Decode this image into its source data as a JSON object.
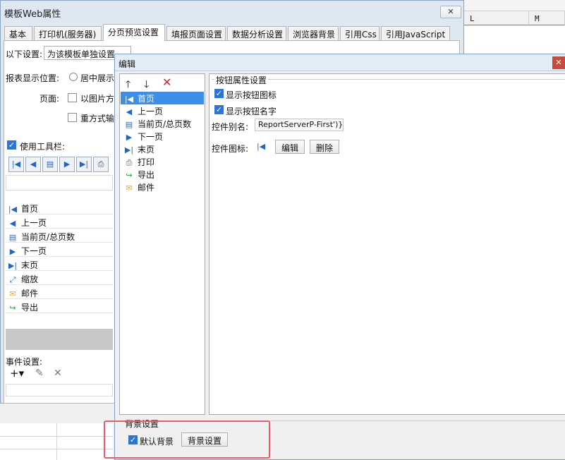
{
  "sheet": {
    "col_l": "L",
    "col_m": "M"
  },
  "main_dialog": {
    "title": "模板Web属性",
    "close_symbol": "✕",
    "tabs": [
      {
        "label": "基本"
      },
      {
        "label": "打印机(服务器)"
      },
      {
        "label": "分页预览设置"
      },
      {
        "label": "填报页面设置"
      },
      {
        "label": "数据分析设置"
      },
      {
        "label": "浏览器背景"
      },
      {
        "label": "引用Css"
      },
      {
        "label": "引用JavaScript"
      }
    ],
    "settings_label": "以下设置:",
    "settings_value": "为该模板单独设置",
    "report_pos_label": "报表显示位置:",
    "report_pos_option": "居中展示",
    "page_label": "页面:",
    "page_option": "以图片方",
    "reflow_option": "重方式输",
    "use_toolbar_label": "使用工具栏:",
    "toolbar_items": [
      {
        "label": "首页",
        "icon": "first-page-icon",
        "glyph": "|◀"
      },
      {
        "label": "上一页",
        "icon": "prev-page-icon",
        "glyph": "◀"
      },
      {
        "label": "当前页/总页数",
        "icon": "page-count-icon",
        "glyph": "▤"
      },
      {
        "label": "下一页",
        "icon": "next-page-icon",
        "glyph": "▶"
      },
      {
        "label": "末页",
        "icon": "last-page-icon",
        "glyph": "▶|"
      },
      {
        "label": "缩放",
        "icon": "zoom-icon",
        "glyph": "⤢"
      },
      {
        "label": "邮件",
        "icon": "mail-icon",
        "glyph": "✉"
      },
      {
        "label": "导出",
        "icon": "export-icon",
        "glyph": "↪"
      }
    ],
    "event_label": "事件设置:",
    "add_symbol": "+▾",
    "edit_symbol": "✎",
    "delete_symbol": "✕"
  },
  "edit_dialog": {
    "title": "编辑",
    "close_symbol": "✕",
    "up_symbol": "🡑",
    "down_symbol": "🡓",
    "remove_symbol": "✕",
    "buttons": [
      {
        "label": "首页",
        "glyph": "|◀"
      },
      {
        "label": "上一页",
        "glyph": "◀"
      },
      {
        "label": "当前页/总页数",
        "glyph": "▤"
      },
      {
        "label": "下一页",
        "glyph": "▶"
      },
      {
        "label": "末页",
        "glyph": "▶|"
      },
      {
        "label": "打印",
        "glyph": "⎙"
      },
      {
        "label": "导出",
        "glyph": "↪"
      },
      {
        "label": "邮件",
        "glyph": "✉"
      }
    ],
    "props_title": "按钮属性设置",
    "show_icon_label": "显示按钮图标",
    "show_name_label": "显示按钮名字",
    "alias_label": "控件别名:",
    "alias_value": "ReportServerP-First')}",
    "icon_label": "控件图标:",
    "icon_glyph": "|◀",
    "edit_button": "编辑",
    "delete_button": "删除",
    "bg_section_title": "背景设置",
    "default_bg_label": "默认背景",
    "bg_settings_button": "背景设置",
    "check_mark": "✓"
  }
}
